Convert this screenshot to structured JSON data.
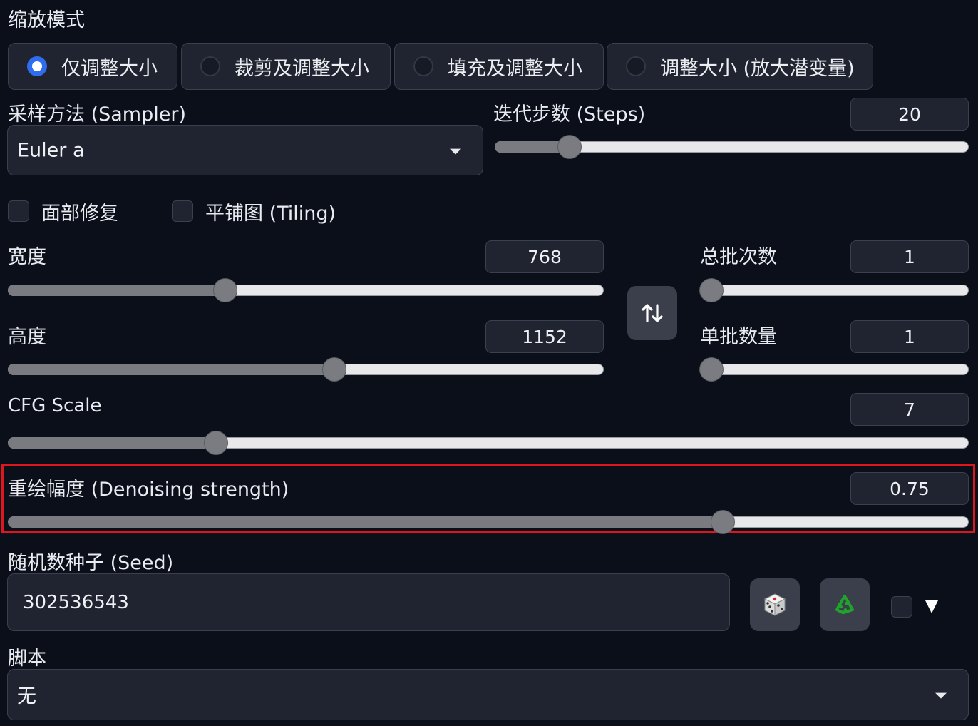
{
  "resize_mode": {
    "label": "缩放模式",
    "options": [
      "仅调整大小",
      "裁剪及调整大小",
      "填充及调整大小",
      "调整大小 (放大潜变量)"
    ],
    "selected_index": 0
  },
  "sampler": {
    "label": "采样方法 (Sampler)",
    "value": "Euler a"
  },
  "steps": {
    "label": "迭代步数 (Steps)",
    "value": "20",
    "fraction": 0.14
  },
  "checkboxes": {
    "face_restore": "面部修复",
    "tiling": "平铺图 (Tiling)"
  },
  "width": {
    "label": "宽度",
    "value": "768",
    "fraction": 0.36
  },
  "height": {
    "label": "高度",
    "value": "1152",
    "fraction": 0.55
  },
  "batch_count": {
    "label": "总批次数",
    "value": "1",
    "fraction": 0.0
  },
  "batch_size": {
    "label": "单批数量",
    "value": "1",
    "fraction": 0.0
  },
  "cfg_scale": {
    "label": "CFG Scale",
    "value": "7",
    "fraction": 0.21
  },
  "denoising": {
    "label": "重绘幅度 (Denoising strength)",
    "value": "0.75",
    "fraction": 0.75
  },
  "seed": {
    "label": "随机数种子 (Seed)",
    "value": "302536543"
  },
  "script": {
    "label": "脚本",
    "value": "无"
  },
  "colors": {
    "accent": "#2f6cf0",
    "highlight": "#e0161e",
    "recycle_green": "#1fa32a"
  },
  "icons": {
    "swap": "swap-arrows-icon",
    "dice": "dice-icon",
    "recycle": "recycle-icon",
    "expand": "triangle-down-icon"
  }
}
